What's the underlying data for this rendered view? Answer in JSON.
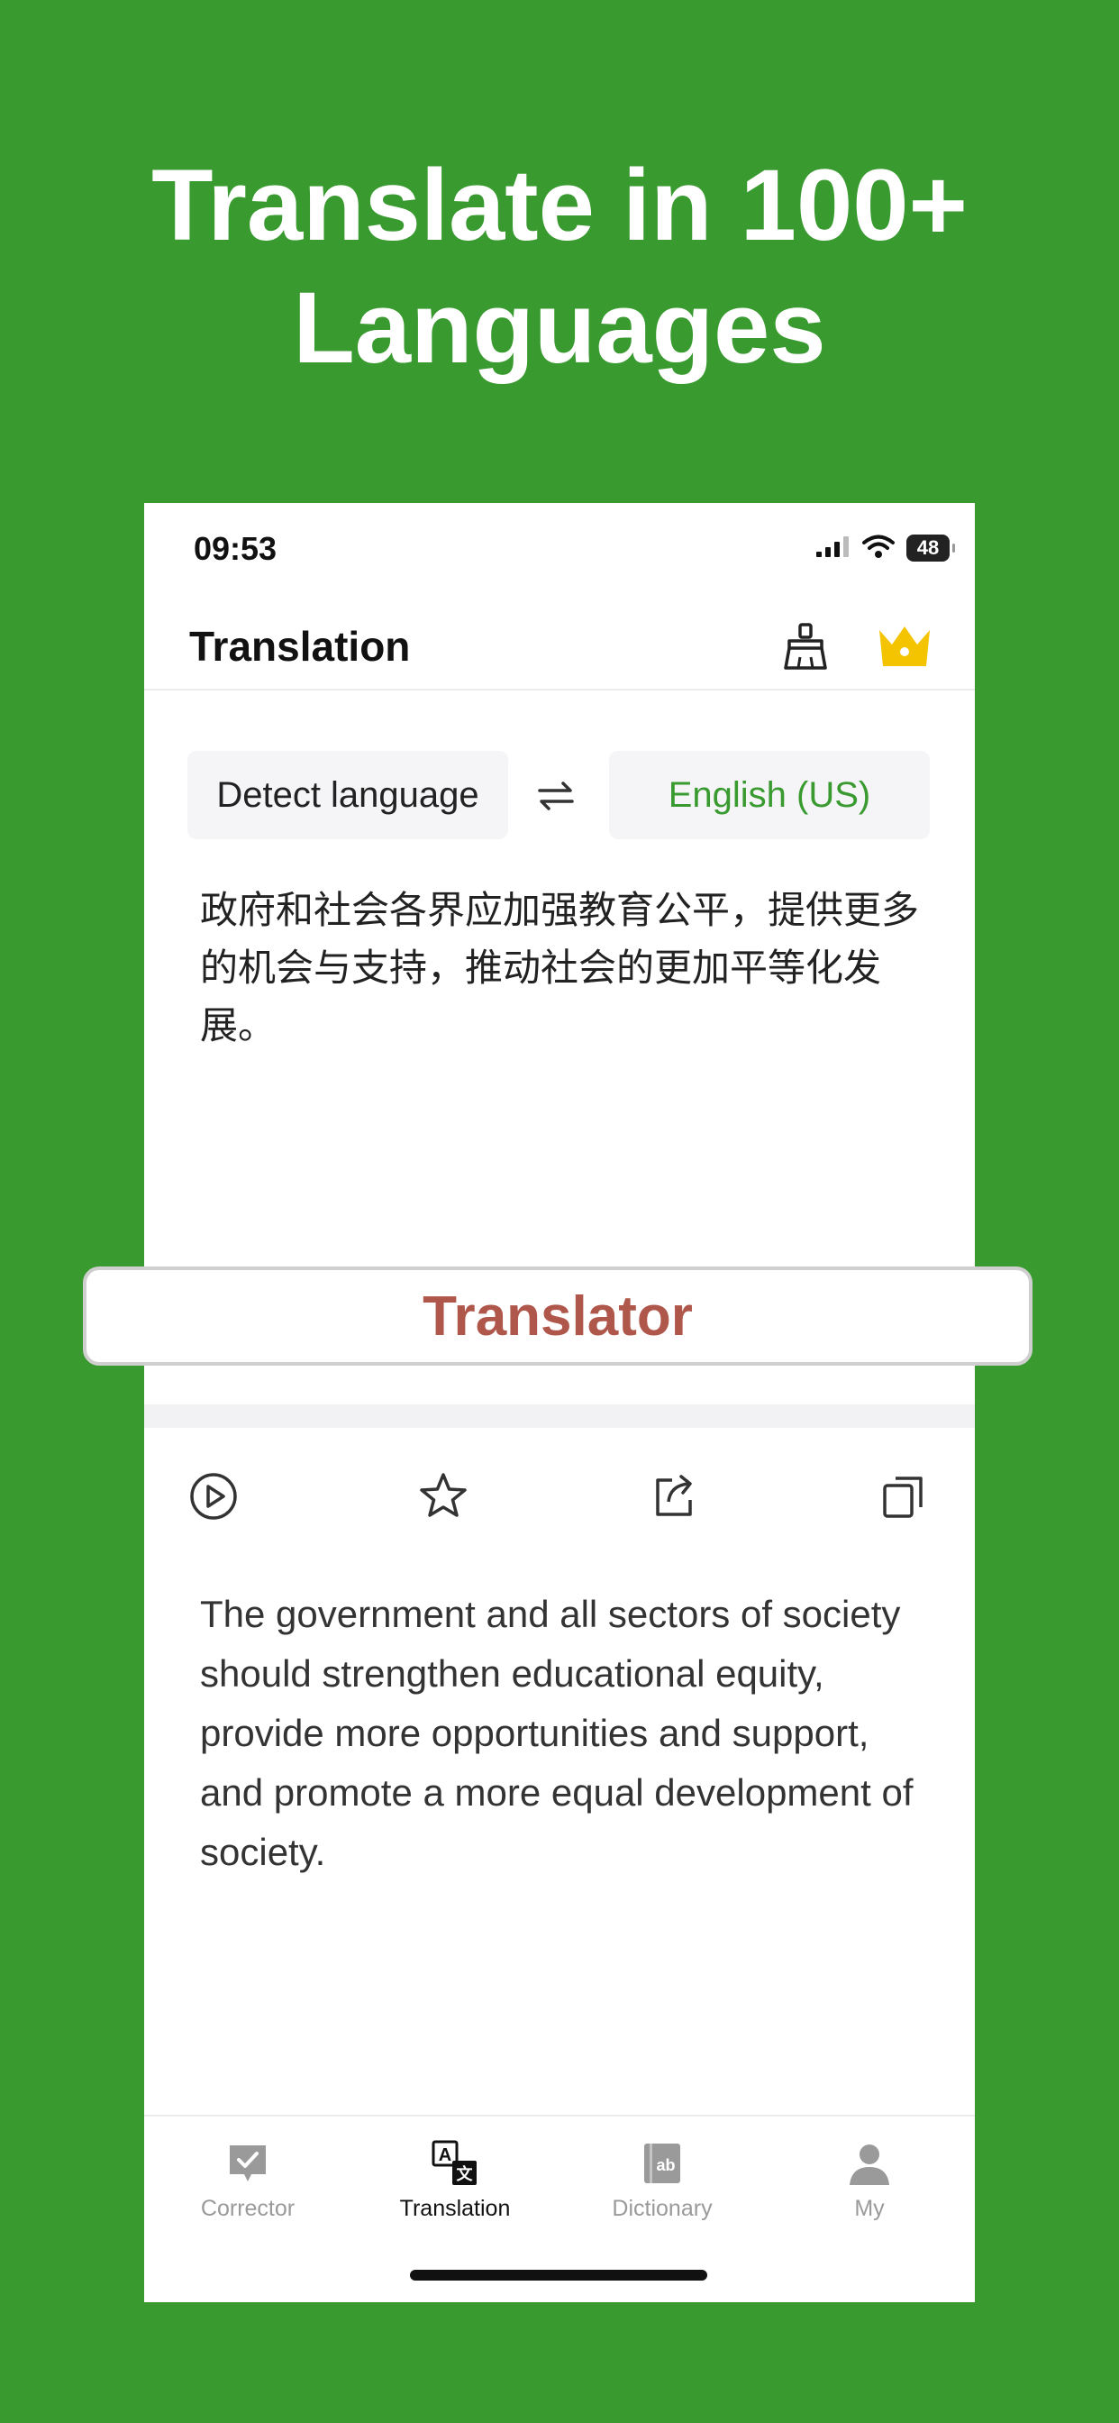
{
  "headline": {
    "line1": "Translate in 100+",
    "line2": "Languages"
  },
  "status_bar": {
    "time": "09:53",
    "battery": "48"
  },
  "header": {
    "title": "Translation",
    "clear_icon": "broom-icon",
    "premium_icon": "crown-icon"
  },
  "languages": {
    "source": "Detect language",
    "target": "English (US)",
    "swap_icon": "swap-arrows-icon"
  },
  "source_text": "政府和社会各界应加强教育公平，提供更多的机会与支持，推动社会的更加平等化发展。",
  "banner": {
    "label": "Translator"
  },
  "actions": {
    "play": "play-icon",
    "favorite": "star-icon",
    "share": "share-icon",
    "copy": "copy-icon"
  },
  "result_text": "The government and all sectors of society should strengthen educational equity, provide more opportunities and support, and promote a more equal development of society.",
  "tabs": [
    {
      "label": "Corrector",
      "icon": "corrector-icon",
      "active": false
    },
    {
      "label": "Translation",
      "icon": "translate-icon",
      "active": true
    },
    {
      "label": "Dictionary",
      "icon": "dictionary-icon",
      "active": false
    },
    {
      "label": "My",
      "icon": "person-icon",
      "active": false
    }
  ],
  "colors": {
    "background": "#389a2f",
    "accent": "#389a2f",
    "crown": "#f5c400",
    "banner_text": "#b0574c"
  }
}
